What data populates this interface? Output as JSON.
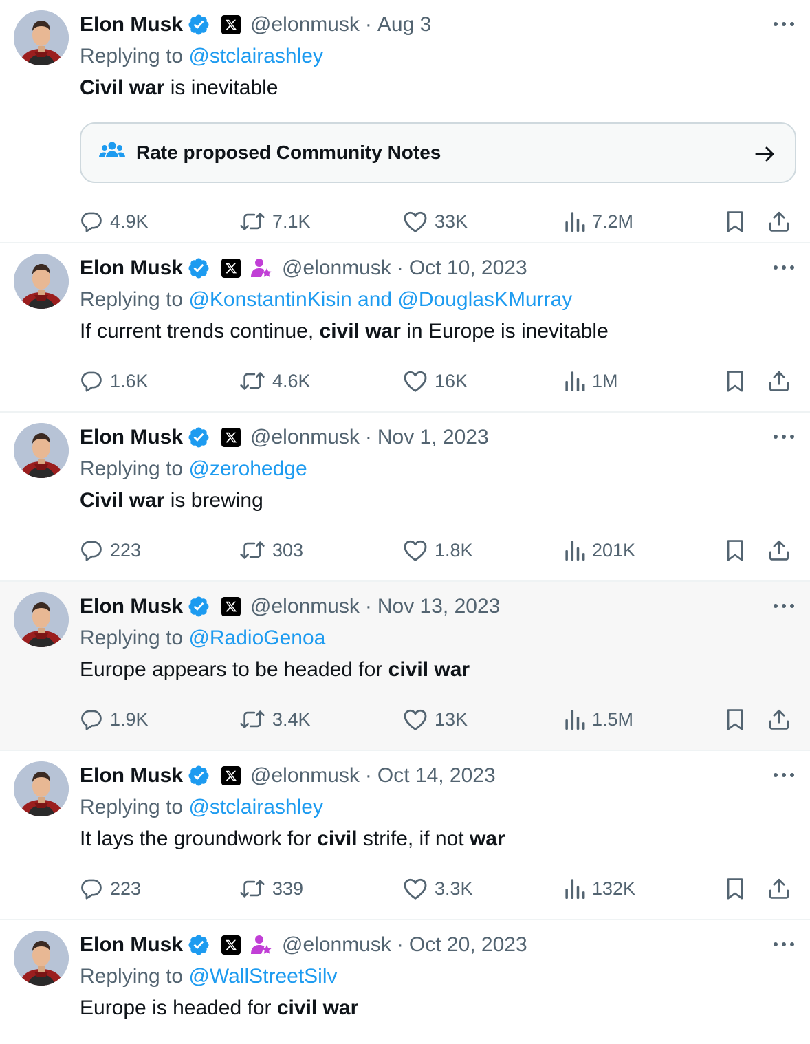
{
  "colors": {
    "accent": "#1d9bf0",
    "secondary_text": "#536471",
    "primary_text": "#0f1419",
    "affiliate_badge": "#c13fd6",
    "verified": "#1d9bf0"
  },
  "tweets": [
    {
      "name": "Elon Musk",
      "handle": "@elonmusk",
      "date": "Aug 3",
      "affiliate_badge": false,
      "highlighted": false,
      "reply_prefix": "Replying to",
      "reply_mentions": "@stclairashley",
      "text_parts": [
        {
          "text": "Civil war",
          "bold": true
        },
        {
          "text": " is inevitable",
          "bold": false
        }
      ],
      "community_note_label": "Rate proposed Community Notes",
      "replies": "4.9K",
      "retweets": "7.1K",
      "likes": "33K",
      "views": "7.2M"
    },
    {
      "name": "Elon Musk",
      "handle": "@elonmusk",
      "date": "Oct 10, 2023",
      "affiliate_badge": true,
      "highlighted": false,
      "reply_prefix": "Replying to",
      "reply_mentions": "@KonstantinKisin and @DouglasKMurray",
      "text_parts": [
        {
          "text": "If current trends continue, ",
          "bold": false
        },
        {
          "text": "civil war",
          "bold": true
        },
        {
          "text": " in Europe is inevitable",
          "bold": false
        }
      ],
      "replies": "1.6K",
      "retweets": "4.6K",
      "likes": "16K",
      "views": "1M"
    },
    {
      "name": "Elon Musk",
      "handle": "@elonmusk",
      "date": "Nov 1, 2023",
      "affiliate_badge": false,
      "highlighted": false,
      "reply_prefix": "Replying to",
      "reply_mentions": "@zerohedge",
      "text_parts": [
        {
          "text": "Civil war",
          "bold": true
        },
        {
          "text": " is brewing",
          "bold": false
        }
      ],
      "replies": "223",
      "retweets": "303",
      "likes": "1.8K",
      "views": "201K"
    },
    {
      "name": "Elon Musk",
      "handle": "@elonmusk",
      "date": "Nov 13, 2023",
      "affiliate_badge": false,
      "highlighted": true,
      "reply_prefix": "Replying to",
      "reply_mentions": "@RadioGenoa",
      "text_parts": [
        {
          "text": "Europe appears to be headed for ",
          "bold": false
        },
        {
          "text": "civil war",
          "bold": true
        }
      ],
      "replies": "1.9K",
      "retweets": "3.4K",
      "likes": "13K",
      "views": "1.5M"
    },
    {
      "name": "Elon Musk",
      "handle": "@elonmusk",
      "date": "Oct 14, 2023",
      "affiliate_badge": false,
      "highlighted": false,
      "reply_prefix": "Replying to",
      "reply_mentions": "@stclairashley",
      "text_parts": [
        {
          "text": "It lays the groundwork for ",
          "bold": false
        },
        {
          "text": "civil",
          "bold": true
        },
        {
          "text": " strife, if not ",
          "bold": false
        },
        {
          "text": "war",
          "bold": true
        }
      ],
      "replies": "223",
      "retweets": "339",
      "likes": "3.3K",
      "views": "132K"
    },
    {
      "name": "Elon Musk",
      "handle": "@elonmusk",
      "date": "Oct 20, 2023",
      "affiliate_badge": true,
      "highlighted": false,
      "reply_prefix": "Replying to",
      "reply_mentions": "@WallStreetSilv",
      "text_parts": [
        {
          "text": "Europe is headed for ",
          "bold": false
        },
        {
          "text": "civil war",
          "bold": true
        }
      ]
    }
  ],
  "separator": "·",
  "icons": {
    "verified": "verified-badge-icon",
    "x_logo": "x-logo-icon",
    "affiliate": "affiliate-badge-icon",
    "more": "more-dots-icon",
    "reply": "reply-icon",
    "retweet": "retweet-icon",
    "like": "heart-icon",
    "views": "views-icon",
    "bookmark": "bookmark-icon",
    "share": "share-icon",
    "community_notes": "community-notes-icon",
    "arrow": "arrow-right-icon"
  }
}
